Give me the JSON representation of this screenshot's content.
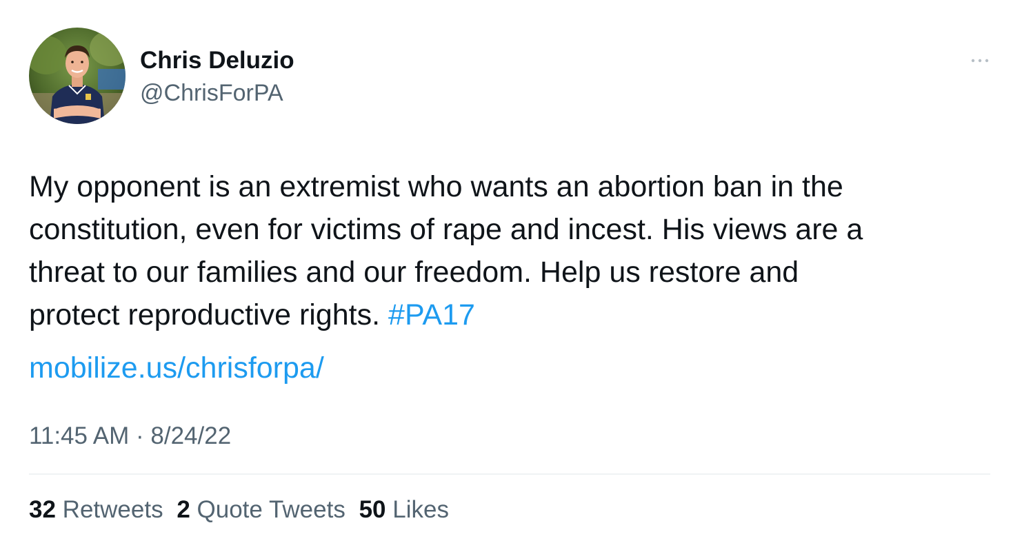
{
  "author": {
    "display_name": "Chris Deluzio",
    "handle": "@ChrisForPA",
    "avatar_icon": "profile-photo"
  },
  "more_icon": "ellipsis-icon",
  "tweet": {
    "lines": [
      "My opponent is an extremist who wants an abortion ban in the",
      "constitution, even for victims of rape and incest. His views are a",
      "threat to our families and our freedom. Help us restore and",
      "protect reproductive rights. "
    ],
    "hashtag": "#PA17",
    "link": "mobilize.us/chrisforpa/"
  },
  "meta": {
    "time": "11:45 AM",
    "separator": " · ",
    "date": "8/24/22"
  },
  "stats": {
    "retweets_count": "32",
    "retweets_label": "Retweets",
    "quotes_count": "2",
    "quotes_label": "Quote Tweets",
    "likes_count": "50",
    "likes_label": "Likes"
  },
  "colors": {
    "link": "#1d9bf0",
    "text": "#0f1419",
    "secondary": "#536471",
    "divider": "#eff3f4"
  }
}
